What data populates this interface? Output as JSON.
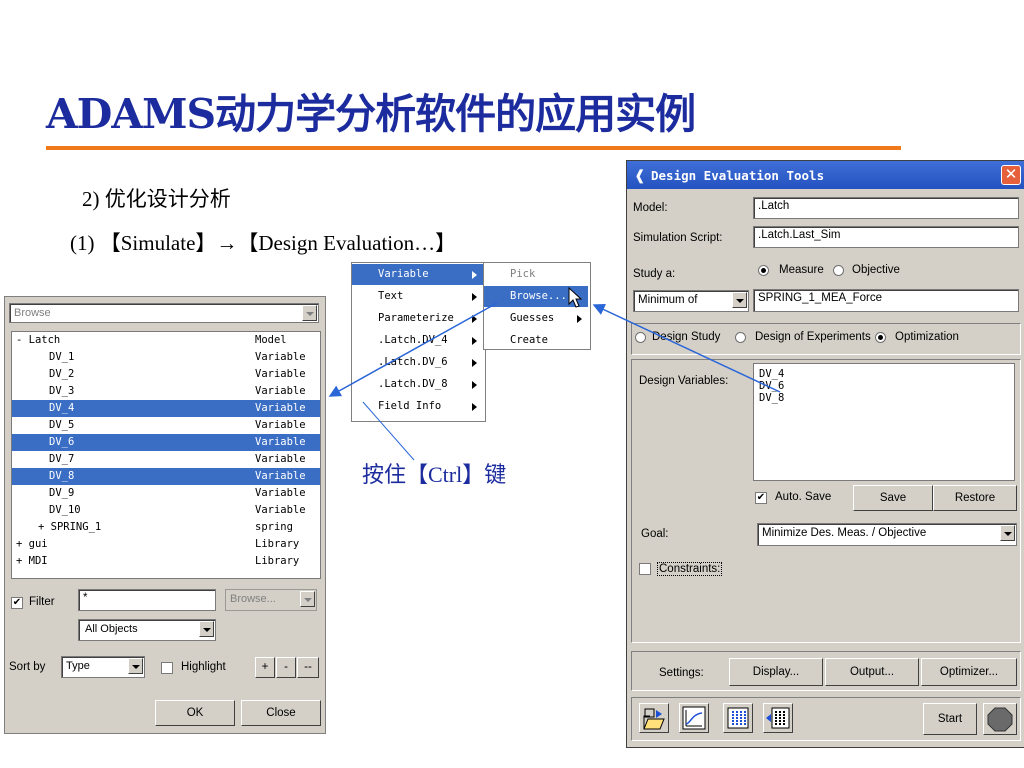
{
  "slide": {
    "title": "ADAMS动力学分析软件的应用实例",
    "subtitle_num": "2)",
    "subtitle_text": "优化设计分析",
    "step": "(1) 【Simulate】→【Design Evaluation…】",
    "ctrl_note": "按住【Ctrl】键"
  },
  "browse_panel": {
    "top_combo": "Browse",
    "tree_rows": [
      {
        "name": "- Latch",
        "type": "Model",
        "indent": 0,
        "selected": false
      },
      {
        "name": "DV_1",
        "type": "Variable",
        "indent": 3,
        "selected": false
      },
      {
        "name": "DV_2",
        "type": "Variable",
        "indent": 3,
        "selected": false
      },
      {
        "name": "DV_3",
        "type": "Variable",
        "indent": 3,
        "selected": false
      },
      {
        "name": "DV_4",
        "type": "Variable",
        "indent": 3,
        "selected": true
      },
      {
        "name": "DV_5",
        "type": "Variable",
        "indent": 3,
        "selected": false
      },
      {
        "name": "DV_6",
        "type": "Variable",
        "indent": 3,
        "selected": true
      },
      {
        "name": "DV_7",
        "type": "Variable",
        "indent": 3,
        "selected": false
      },
      {
        "name": "DV_8",
        "type": "Variable",
        "indent": 3,
        "selected": true
      },
      {
        "name": "DV_9",
        "type": "Variable",
        "indent": 3,
        "selected": false
      },
      {
        "name": "DV_10",
        "type": "Variable",
        "indent": 3,
        "selected": false
      },
      {
        "name": "+ SPRING_1",
        "type": "spring",
        "indent": 2,
        "selected": false
      },
      {
        "name": "+ gui",
        "type": "Library",
        "indent": 0,
        "selected": false
      },
      {
        "name": "+ MDI",
        "type": "Library",
        "indent": 0,
        "selected": false
      }
    ],
    "filter_label": "Filter",
    "filter_checked": true,
    "filter_value": "*",
    "filter_browse": "Browse...",
    "objects_combo": "All Objects",
    "sort_label": "Sort by",
    "sort_combo": "Type",
    "highlight_label": "Highlight",
    "zoom_buttons": [
      "+",
      "-",
      "--"
    ],
    "ok_label": "OK",
    "close_label": "Close"
  },
  "menu_main": {
    "items": [
      {
        "label": "Variable",
        "arrow": true,
        "highlight": true
      },
      {
        "label": "Text",
        "arrow": true,
        "highlight": false
      },
      {
        "label": "Parameterize",
        "arrow": true,
        "highlight": false
      },
      {
        "label": ".Latch.DV_4",
        "arrow": true,
        "highlight": false
      },
      {
        "label": ".Latch.DV_6",
        "arrow": true,
        "highlight": false
      },
      {
        "label": ".Latch.DV_8",
        "arrow": true,
        "highlight": false
      },
      {
        "label": "Field Info",
        "arrow": true,
        "highlight": false
      }
    ]
  },
  "menu_sub": {
    "items": [
      {
        "label": "Pick",
        "arrow": false,
        "highlight": false,
        "disabled": true
      },
      {
        "label": "Browse...",
        "arrow": false,
        "highlight": true,
        "disabled": false
      },
      {
        "label": "Guesses",
        "arrow": true,
        "highlight": false,
        "disabled": false
      },
      {
        "label": "Create",
        "arrow": false,
        "highlight": false,
        "disabled": false
      }
    ]
  },
  "det": {
    "title": "Design Evaluation Tools",
    "model_label": "Model:",
    "model_value": ".Latch",
    "script_label": "Simulation Script:",
    "script_value": ".Latch.Last_Sim",
    "study_label": "Study a:",
    "measure_label": "Measure",
    "objective_label": "Objective",
    "measure_selected": true,
    "min_combo": "Minimum of",
    "measure_value": "SPRING_1_MEA_Force",
    "design_study_label": "Design Study",
    "doe_label": "Design of Experiments",
    "optimization_label": "Optimization",
    "optimization_selected": true,
    "dv_label": "Design Variables:",
    "dv_values": [
      "DV_4",
      "DV_6",
      "DV_8"
    ],
    "autosave_label": "Auto. Save",
    "autosave_checked": true,
    "save_label": "Save",
    "restore_label": "Restore",
    "goal_label": "Goal:",
    "goal_value": "Minimize Des. Meas. / Objective",
    "constraints_label": "Constraints:",
    "settings_label": "Settings:",
    "display_label": "Display...",
    "output_label": "Output...",
    "optimizer_label": "Optimizer...",
    "start_label": "Start"
  },
  "colors": {
    "title": "#1c2c9e",
    "rule": "#f07a1a",
    "selection": "#3a6dc4",
    "arrow": "#2a66d8"
  }
}
